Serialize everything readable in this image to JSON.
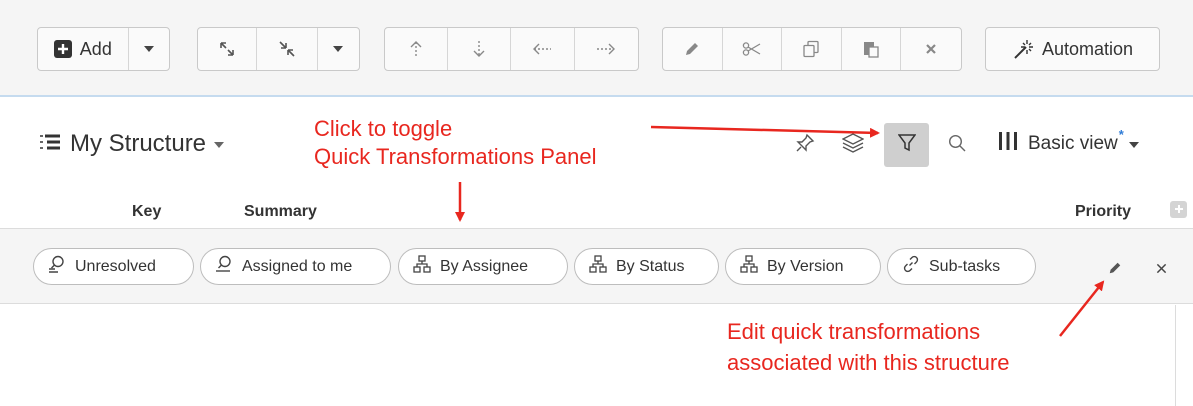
{
  "toolbar": {
    "add_label": "Add",
    "automation_label": "Automation",
    "icons": [
      "plus-square-icon",
      "chevron-down-icon",
      "expand-icon",
      "collapse-icon",
      "arrow-up-icon",
      "arrow-down-icon",
      "arrow-left-icon",
      "arrow-right-icon",
      "pencil-icon",
      "scissors-icon",
      "copy-icon",
      "paste-icon",
      "close-icon",
      "magic-wand-icon"
    ]
  },
  "header": {
    "structure_name": "My Structure",
    "view_name": "Basic view",
    "view_modified_marker": "*",
    "icons": [
      "structure-icon",
      "pin-icon",
      "layers-icon",
      "filter-icon",
      "search-icon",
      "columns-icon"
    ]
  },
  "columns": {
    "key": "Key",
    "summary": "Summary",
    "priority": "Priority"
  },
  "quick_transformations": [
    {
      "icon": "filter-search-icon",
      "label": "Unresolved"
    },
    {
      "icon": "search-icon",
      "label": "Assigned to me"
    },
    {
      "icon": "group-icon",
      "label": "By Assignee"
    },
    {
      "icon": "group-icon",
      "label": "By Status"
    },
    {
      "icon": "group-icon",
      "label": "By Version"
    },
    {
      "icon": "link-icon",
      "label": "Sub-tasks"
    }
  ],
  "annotations": {
    "toggle_line1": "Click to toggle",
    "toggle_line2": "Quick Transformations Panel",
    "edit_line1": "Edit quick transformations",
    "edit_line2": "associated with this structure"
  },
  "colors": {
    "annotation": "#e8271f",
    "toolbar_bg": "#f5f5f5",
    "accent_blue": "#2e7bd6"
  }
}
